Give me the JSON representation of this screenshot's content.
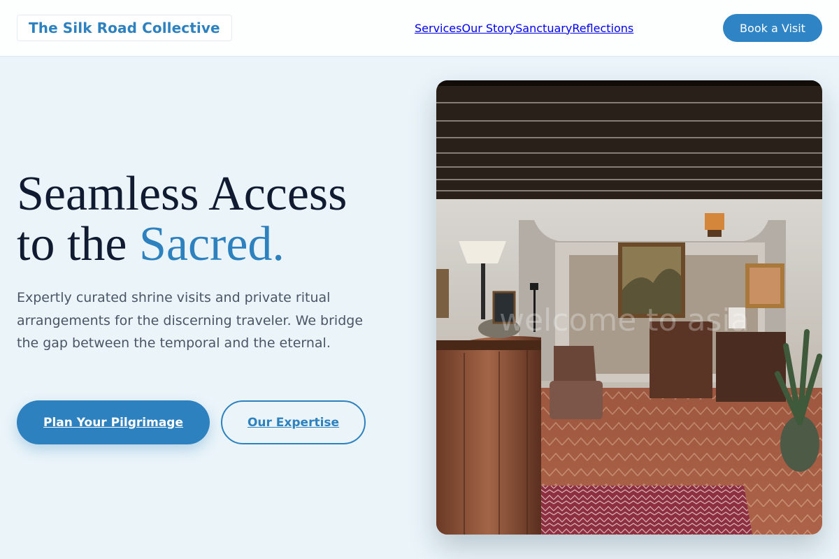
{
  "header": {
    "logo": "The Silk Road Collective",
    "nav": [
      "Services",
      "Our Story",
      "Sanctuary",
      "Reflections"
    ],
    "cta": "Book a Visit"
  },
  "hero": {
    "headline_line1": "Seamless Access",
    "headline_line2_prefix": "to the ",
    "headline_accent": "Sacred.",
    "subcopy": "Expertly curated shrine visits and private ritual arrangements for the discerning traveler. We bridge the gap between the temporal and the eternal.",
    "primary_cta": "Plan Your Pilgrimage",
    "secondary_cta": "Our Expertise",
    "image_watermark": "welcome to asia"
  },
  "colors": {
    "accent": "#2e81bf",
    "background": "#eaf4f9",
    "heading": "#101a30",
    "body_text": "#4a5565"
  }
}
